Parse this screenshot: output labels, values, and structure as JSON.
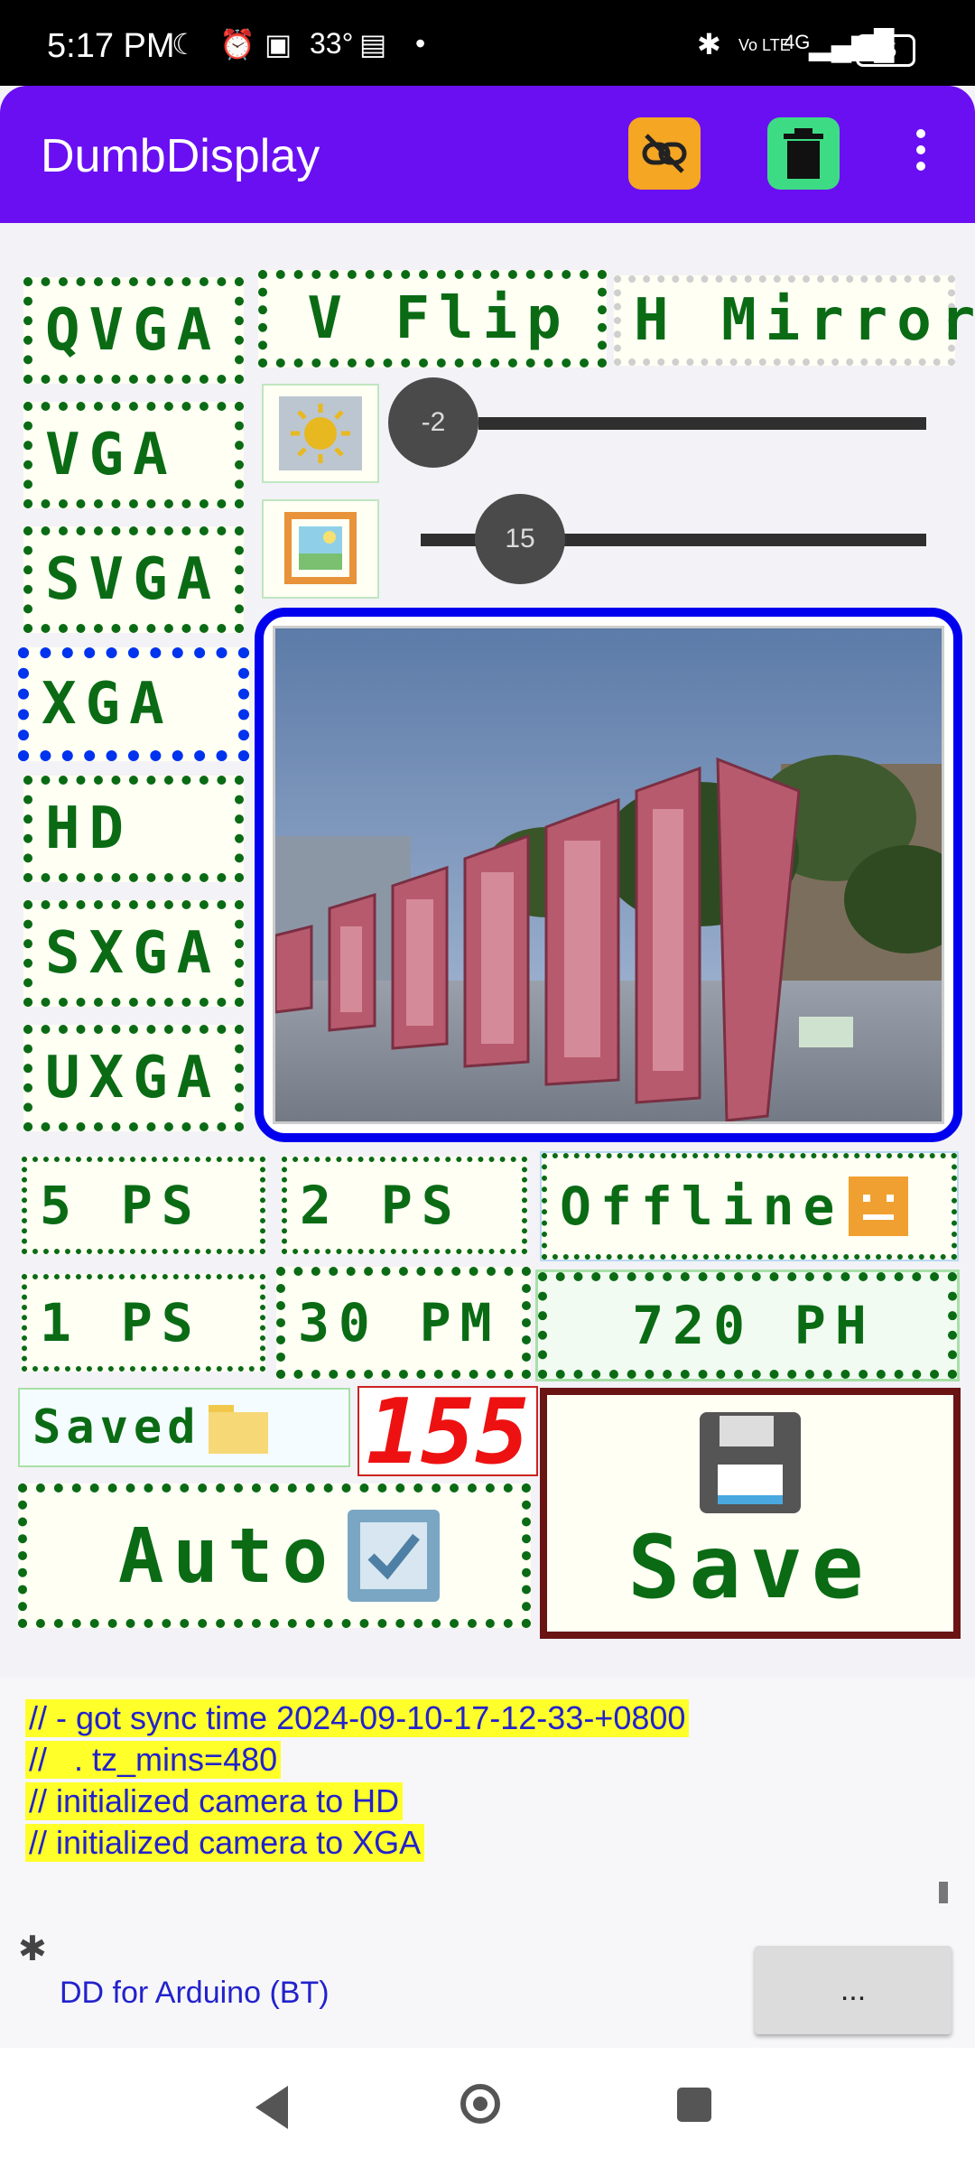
{
  "status_bar": {
    "time": "5:17 PM",
    "temperature": "33°",
    "network": "4G",
    "battery": "55",
    "volte": "Vo LTE"
  },
  "app_bar": {
    "title": "DumbDisplay",
    "unlink_icon": "link-off-icon",
    "trash_icon": "trash-icon",
    "menu_icon": "more-vert-icon"
  },
  "resolutions": [
    "QVGA",
    "VGA",
    "SVGA",
    "XGA",
    "HD",
    "SXGA",
    "UXGA"
  ],
  "selected_resolution": "XGA",
  "toggles": {
    "vflip": "V Flip",
    "hmirror": "H Mirror"
  },
  "sliders": {
    "brightness": {
      "icon": "sun-icon",
      "value": "-2",
      "min": -2,
      "max": 2
    },
    "quality": {
      "icon": "image-icon",
      "value": "15",
      "min": 10,
      "max": 63
    }
  },
  "camera_view": {
    "description_icon": "camera-frame"
  },
  "frame_rates": [
    "5 PS",
    "2 PS",
    "1 PS",
    "30 PM",
    "720 PH"
  ],
  "selected_frame_rates": [
    "30 PM"
  ],
  "offline": {
    "label": "Offline",
    "icon": "offline-face-icon"
  },
  "saved": {
    "label": "Saved",
    "icon": "folder-icon",
    "count": "155"
  },
  "auto": {
    "label": "Auto",
    "icon": "checkbox-icon"
  },
  "save": {
    "label": "Save",
    "icon": "floppy-icon"
  },
  "log_lines": [
    "// - got sync time 2024-09-10-17-12-33-+0800",
    "//   . tz_mins=480",
    "// initialized camera to HD",
    "// initialized camera to XGA"
  ],
  "connection": {
    "label": "DD for Arduino (BT)",
    "more_button": "..."
  },
  "colors": {
    "app_bar": "#6a0ff2",
    "dot_green": "#0a6b14",
    "select_blue": "#0000ee",
    "seg_red": "#ee1111",
    "log_highlight": "#ffff2a"
  }
}
